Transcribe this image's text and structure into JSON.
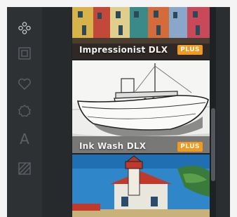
{
  "toolbar": {
    "tools": [
      {
        "icon": "effects-icon"
      },
      {
        "icon": "frame-icon"
      },
      {
        "icon": "heart-icon"
      },
      {
        "icon": "settings-icon"
      },
      {
        "icon": "text-icon",
        "glyph": "A"
      },
      {
        "icon": "texture-icon"
      }
    ]
  },
  "effects": {
    "items": [
      {
        "name": "Impressionist DLX",
        "badge": "PLUS"
      },
      {
        "name": "Ink Wash DLX",
        "badge": "PLUS"
      },
      {
        "name": "",
        "badge": ""
      }
    ]
  },
  "colors": {
    "badge": "#f39a1e",
    "panel": "#1f2225",
    "toolbar": "#2e3134"
  }
}
